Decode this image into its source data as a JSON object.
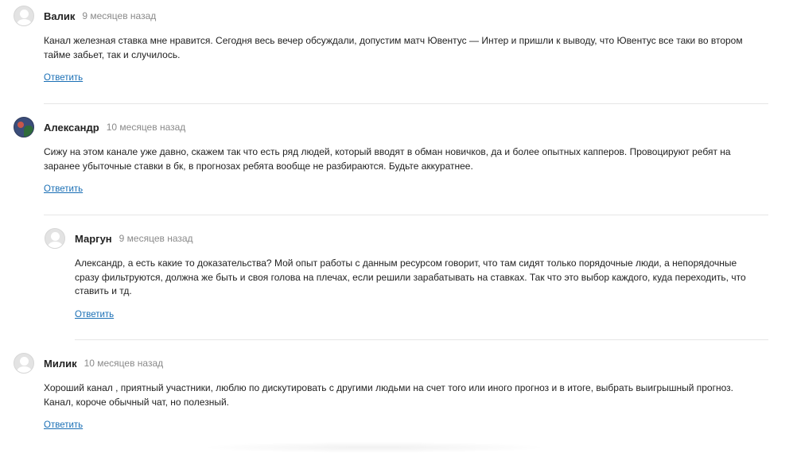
{
  "comments": [
    {
      "author": "Валик",
      "date": "9 месяцев назад",
      "text_lines": [
        "Канал железная ставка мне нравится. Сегодня весь вечер обсуждали, допустим матч Ювентус — Интер и пришли к выводу, что Ювентус все таки во втором",
        "тайме забьет, так и случилось."
      ],
      "reply_label": "Ответить",
      "avatar": "default-avatar-icon"
    },
    {
      "author": "Александр",
      "date": "10 месяцев назад",
      "text_lines": [
        "Сижу на этом канале уже давно, скажем так что есть ряд людей, который вводят в обман новичков, да и более опытных капперов. Провоцируют ребят на",
        "заранее убыточные ставки в бк, в прогнозах ребята вообще не разбираются. Будьте аккуратнее."
      ],
      "reply_label": "Ответить",
      "avatar": "user-photo-avatar"
    },
    {
      "author": "Маргун",
      "date": "9 месяцев назад",
      "text_lines": [
        "Александр, а есть какие то доказательства? Мой опыт работы с данным ресурсом говорит, что там сидят только порядочные люди, а непорядочные",
        "сразу фильтруются, должна же быть и своя голова на плечах, если решили зарабатывать на ставках. Так что это выбор каждого, куда переходить, что",
        "ставить и тд."
      ],
      "reply_label": "Ответить",
      "avatar": "default-avatar-icon"
    },
    {
      "author": "Милик",
      "date": "10 месяцев назад",
      "text_lines": [
        "Хороший канал , приятный участники, люблю по дискутировать с другими людьми на счет того или иного прогноз и в итоге, выбрать выигрышный прогноз.",
        "Канал, короче обычный чат, но полезный."
      ],
      "reply_label": "Ответить",
      "avatar": "default-avatar-icon"
    }
  ]
}
